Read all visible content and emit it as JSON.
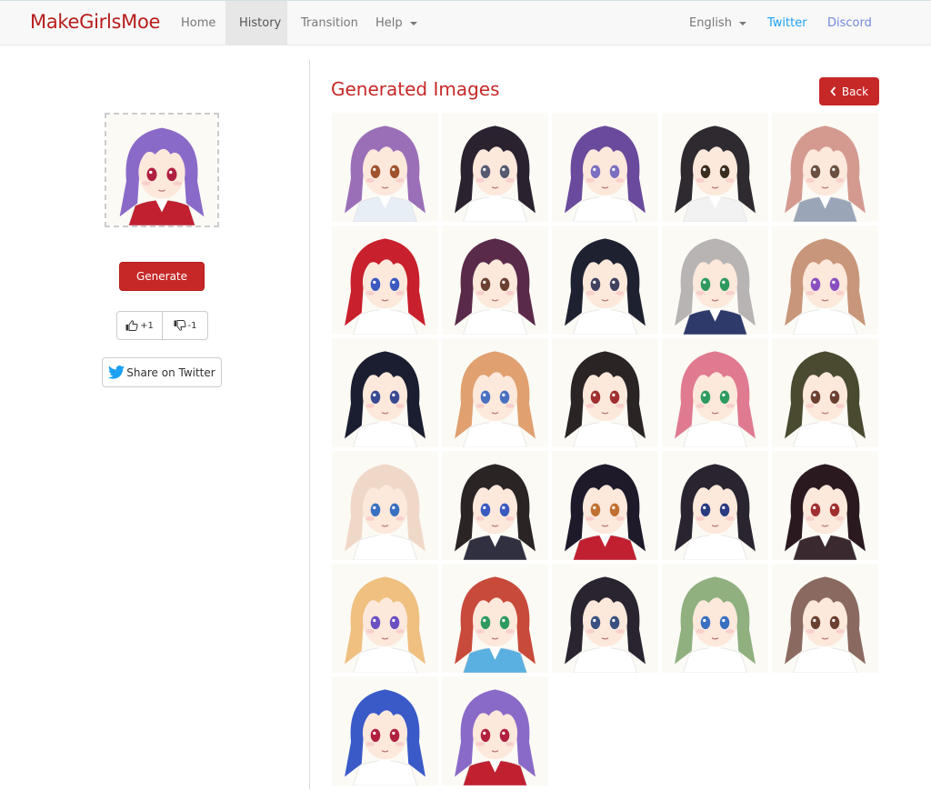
{
  "navbar": {
    "brand": "MakeGirlsMoe",
    "items": [
      {
        "label": "Home",
        "active": false
      },
      {
        "label": "History",
        "active": true
      },
      {
        "label": "Transition",
        "active": false
      },
      {
        "label": "Help",
        "active": false,
        "dropdown": true
      }
    ],
    "language": "English",
    "twitter": "Twitter",
    "discord": "Discord"
  },
  "sidebar": {
    "preview_alt": "Current generated character: purple short hair, red eyes",
    "generate_label": "Generate",
    "upvote_label": "+1",
    "downvote_label": "-1",
    "share_label": "Share on Twitter"
  },
  "main": {
    "title": "Generated Images",
    "back_label": "Back",
    "images": [
      {
        "hair": "#9b6fb8",
        "eyes": "#a0522d",
        "outfit": "#e8eef5"
      },
      {
        "hair": "#2b2230",
        "eyes": "#555a70",
        "outfit": "#ffffff"
      },
      {
        "hair": "#6a4a9c",
        "eyes": "#7a6fc0",
        "outfit": "#ffffff"
      },
      {
        "hair": "#2e2a30",
        "eyes": "#3b2c20",
        "outfit": "#f2f2f2"
      },
      {
        "hair": "#d49a90",
        "eyes": "#6b5040",
        "outfit": "#9aa6b8"
      },
      {
        "hair": "#c8202c",
        "eyes": "#3a5ac0",
        "outfit": "#ffffff"
      },
      {
        "hair": "#5a2a4a",
        "eyes": "#6b4030",
        "outfit": "#ffffff"
      },
      {
        "hair": "#1e2130",
        "eyes": "#404060",
        "outfit": "#ffffff"
      },
      {
        "hair": "#b8b4b4",
        "eyes": "#2e9a60",
        "outfit": "#2e3a6a"
      },
      {
        "hair": "#c8967a",
        "eyes": "#8a50c0",
        "outfit": "#ffffff"
      },
      {
        "hair": "#1a1e30",
        "eyes": "#3a4a90",
        "outfit": "#ffffff"
      },
      {
        "hair": "#e0a070",
        "eyes": "#4a70c0",
        "outfit": "#ffffff"
      },
      {
        "hair": "#2a2424",
        "eyes": "#a03030",
        "outfit": "#ffffff"
      },
      {
        "hair": "#e07a90",
        "eyes": "#2e9a60",
        "outfit": "#ffffff"
      },
      {
        "hair": "#4a4a30",
        "eyes": "#6b4030",
        "outfit": "#ffffff"
      },
      {
        "hair": "#f0d8c8",
        "eyes": "#3a70c0",
        "outfit": "#ffffff"
      },
      {
        "hair": "#2a2424",
        "eyes": "#3a5ac0",
        "outfit": "#303040"
      },
      {
        "hair": "#1e1a2a",
        "eyes": "#c07030",
        "outfit": "#c02030"
      },
      {
        "hair": "#2a2430",
        "eyes": "#2a3a80",
        "outfit": "#ffffff"
      },
      {
        "hair": "#2a1a20",
        "eyes": "#a03030",
        "outfit": "#3a2a30"
      },
      {
        "hair": "#f0c080",
        "eyes": "#6a50c0",
        "outfit": "#ffffff"
      },
      {
        "hair": "#c84a3a",
        "eyes": "#2e9a60",
        "outfit": "#5ab0e0"
      },
      {
        "hair": "#2a2430",
        "eyes": "#3a5080",
        "outfit": "#ffffff"
      },
      {
        "hair": "#90b080",
        "eyes": "#3a70c0",
        "outfit": "#ffffff"
      },
      {
        "hair": "#8a6a60",
        "eyes": "#6b4030",
        "outfit": "#ffffff"
      },
      {
        "hair": "#3a5ac8",
        "eyes": "#b02040",
        "outfit": "#ffffff"
      },
      {
        "hair": "#8a6ac8",
        "eyes": "#b02040",
        "outfit": "#c02030"
      }
    ]
  },
  "preview": {
    "hair": "#8a6ac8",
    "eyes": "#b02040",
    "outfit": "#c02030"
  }
}
